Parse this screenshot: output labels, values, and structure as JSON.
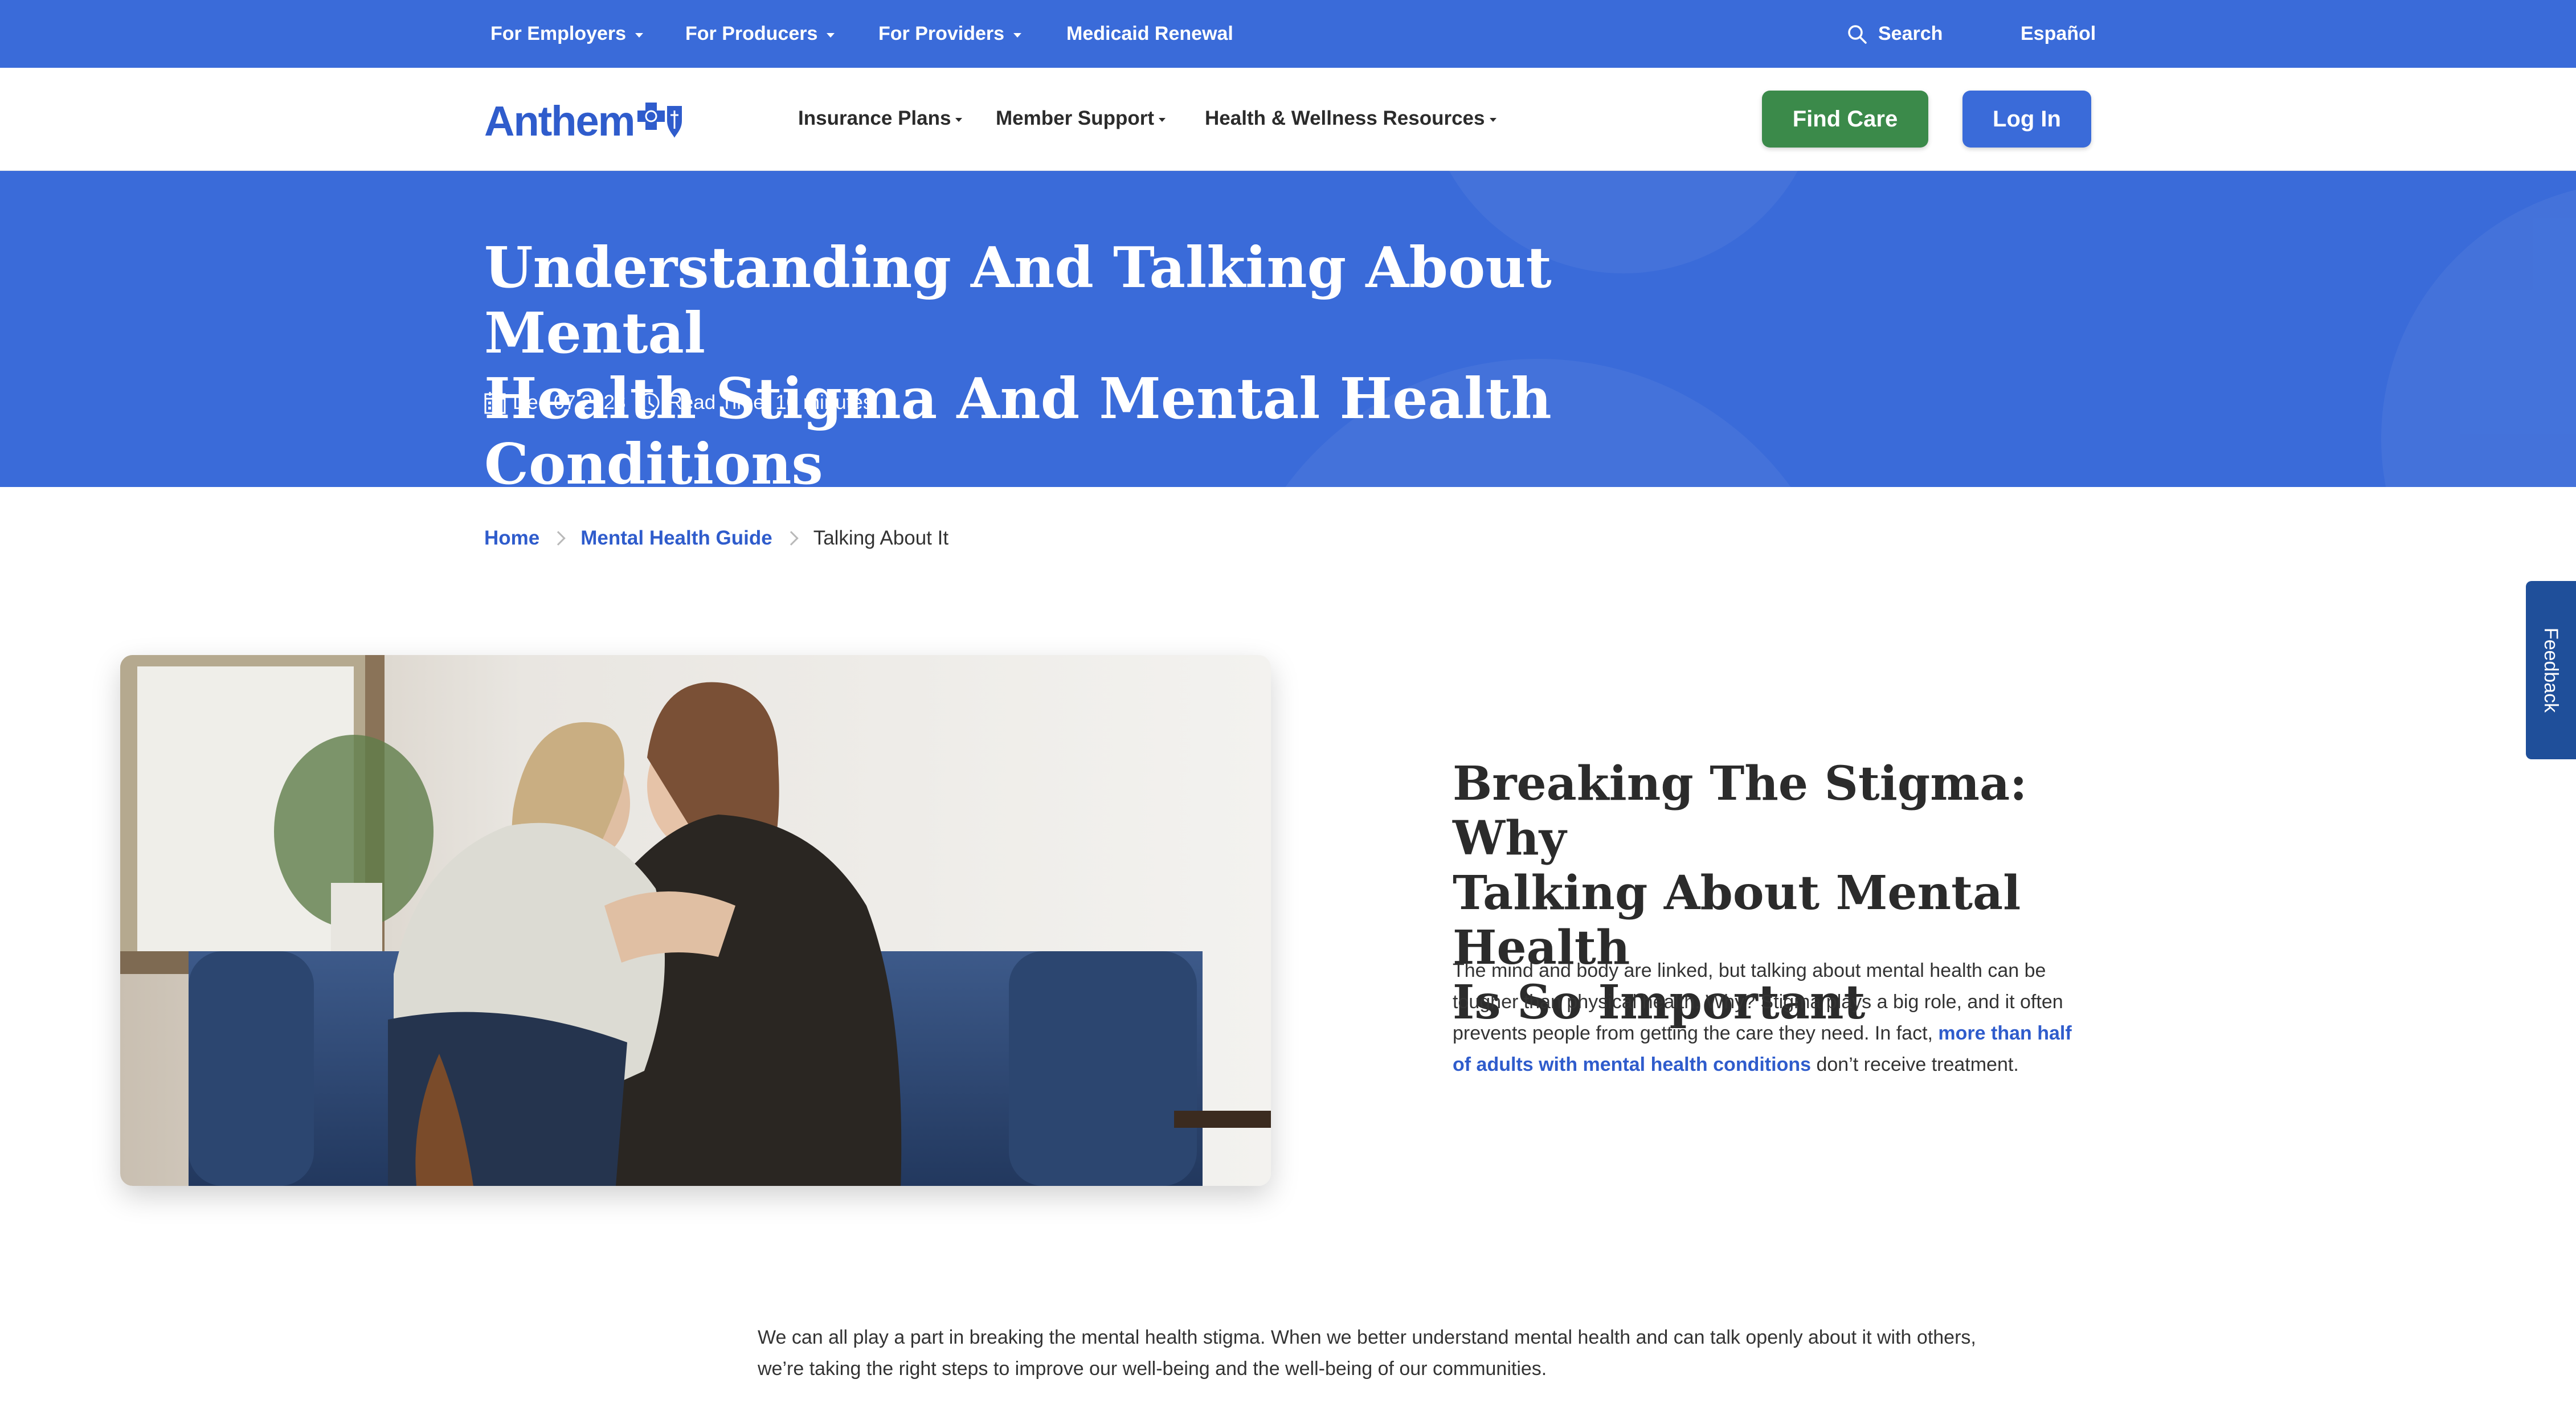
{
  "utility_bar": {
    "items": [
      {
        "label": "For Employers"
      },
      {
        "label": "For Producers"
      },
      {
        "label": "For Providers"
      },
      {
        "label": "Medicaid Renewal"
      }
    ],
    "search_label": "Search",
    "language_label": "Español"
  },
  "header": {
    "logo_text": "Anthem",
    "nav": [
      {
        "label": "Insurance Plans"
      },
      {
        "label": "Member Support"
      },
      {
        "label": "Health & Wellness Resources"
      }
    ],
    "find_care_label": "Find Care",
    "login_label": "Log In"
  },
  "hero": {
    "title_line1": "Understanding And Talking About Mental",
    "title_line2": "Health Stigma And Mental Health Conditions",
    "date": "Dec 07,2023",
    "read_time": "Read Time: 10 minutes"
  },
  "breadcrumb": {
    "home": "Home",
    "guide": "Mental Health Guide",
    "current": "Talking About It"
  },
  "section": {
    "title_line1": "Breaking The Stigma: Why",
    "title_line2": "Talking About Mental Health",
    "title_line3": "Is So Important",
    "body_text": "The mind and body are linked, but talking about mental health can be tougher than physical health. Why? Stigma plays a big role, and it often prevents people from getting the care they need. In fact, ",
    "body_link": "more than half of adults with mental health conditions",
    "body_end": " don’t receive treatment."
  },
  "bottom_paragraph": "We can all play a part in breaking the mental health stigma. When we better understand mental health and can talk openly about it with others, we’re taking the right steps to improve our well-being and the well-being of our communities.",
  "feedback_label": "Feedback",
  "colors": {
    "brand_blue": "#3a6bd9",
    "link_blue": "#2f5ccc",
    "find_care_green": "#3b8a4a",
    "feedback_blue": "#1f4f9a"
  }
}
